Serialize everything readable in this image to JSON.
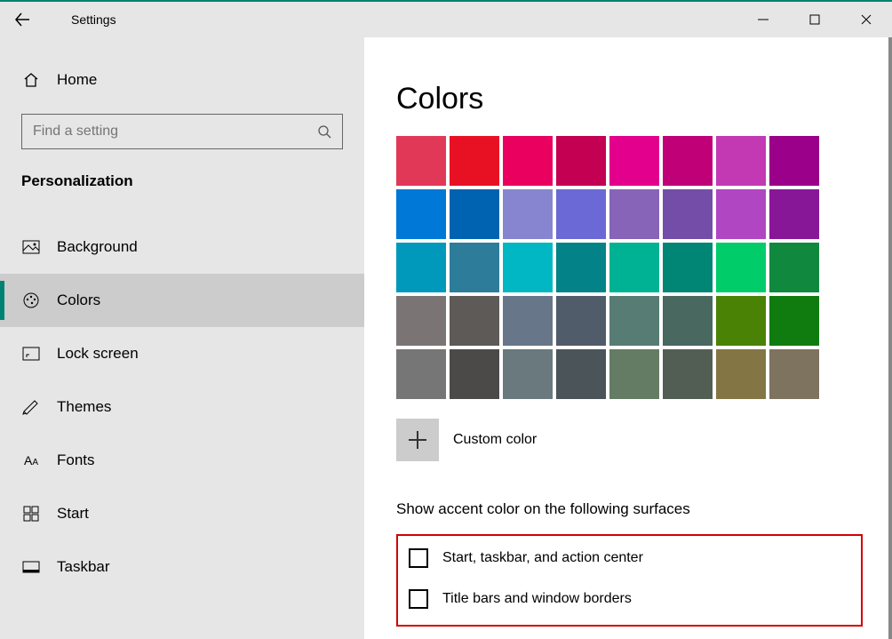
{
  "titlebar": {
    "title": "Settings"
  },
  "sidebar": {
    "home": "Home",
    "search_placeholder": "Find a setting",
    "section": "Personalization",
    "items": [
      {
        "label": "Background"
      },
      {
        "label": "Colors"
      },
      {
        "label": "Lock screen"
      },
      {
        "label": "Themes"
      },
      {
        "label": "Fonts"
      },
      {
        "label": "Start"
      },
      {
        "label": "Taskbar"
      }
    ]
  },
  "content": {
    "heading": "Colors",
    "custom_label": "Custom color",
    "surfaces_heading": "Show accent color on the following surfaces",
    "check1": "Start, taskbar, and action center",
    "check2": "Title bars and window borders",
    "palette": [
      [
        "#e23858",
        "#e81123",
        "#ea005e",
        "#c30052",
        "#e3008c",
        "#bf0077",
        "#c239b3",
        "#9a0089"
      ],
      [
        "#0078d7",
        "#0063b1",
        "#8785d0",
        "#6b69d6",
        "#8764b8",
        "#744da9",
        "#b146c2",
        "#881798"
      ],
      [
        "#0099bc",
        "#2d7d9a",
        "#00b7c3",
        "#038387",
        "#00b294",
        "#018574",
        "#00cc6a",
        "#10893e"
      ],
      [
        "#7a7574",
        "#5d5a58",
        "#68768a",
        "#515c6b",
        "#567c73",
        "#486860",
        "#498205",
        "#107c10"
      ],
      [
        "#767676",
        "#4c4a48",
        "#69797e",
        "#4a5459",
        "#647c64",
        "#525e54",
        "#847545",
        "#7e735f"
      ]
    ]
  }
}
